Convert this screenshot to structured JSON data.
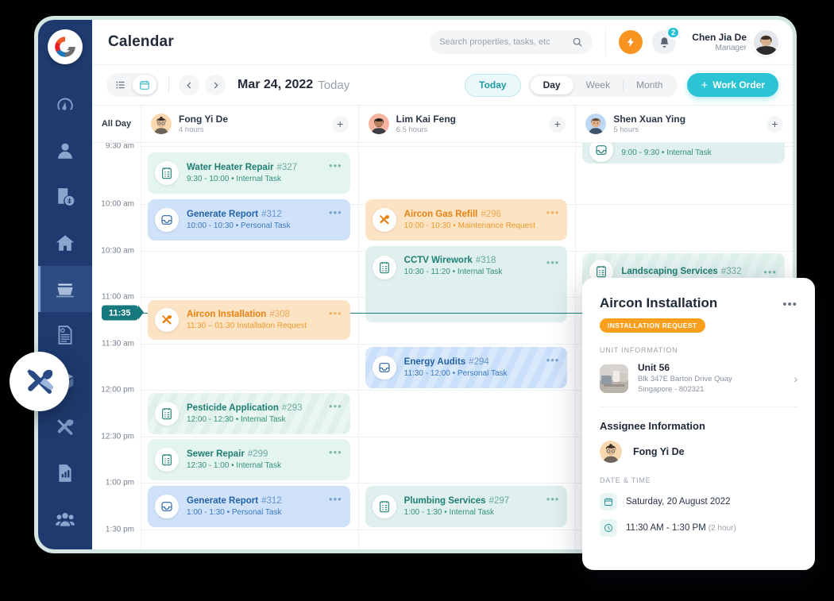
{
  "app": {
    "page_title": "Calendar",
    "search": {
      "placeholder": "Search properties, tasks, etc"
    },
    "notifications_count": "2",
    "user": {
      "name": "Chen Jia De",
      "role": "Manager"
    }
  },
  "toolbar": {
    "date": "Mar 24, 2022",
    "date_suffix": "Today",
    "today_label": "Today",
    "views": [
      "Day",
      "Week",
      "Month"
    ],
    "active_view": "Day",
    "work_order_label": "Work Order",
    "work_order_plus": "+"
  },
  "sidebar": {
    "items": [
      {
        "name": "logo",
        "icon": "brand-logo-icon"
      },
      {
        "name": "dashboard",
        "icon": "gauge-icon"
      },
      {
        "name": "tenants",
        "icon": "user-icon"
      },
      {
        "name": "billing",
        "icon": "invoice-dollar-icon"
      },
      {
        "name": "properties",
        "icon": "house-icon"
      },
      {
        "name": "calendar",
        "icon": "calendar-stack-icon",
        "active": true
      },
      {
        "name": "documents",
        "icon": "document-icon"
      },
      {
        "name": "inventory",
        "icon": "box-icon"
      },
      {
        "name": "maintenance",
        "icon": "tools-icon"
      },
      {
        "name": "reports",
        "icon": "bar-chart-doc-icon"
      },
      {
        "name": "team",
        "icon": "people-icon"
      }
    ]
  },
  "calendar": {
    "all_day_label": "All Day",
    "people": [
      {
        "name": "Fong Yi De",
        "hours": "4 hours",
        "add": "+"
      },
      {
        "name": "Lim Kai Feng",
        "hours": "6.5 hours",
        "add": "+"
      },
      {
        "name": "Shen Xuan Ying",
        "hours": "5 hours",
        "add": "+"
      }
    ],
    "time_labels": [
      "9:30 am",
      "10:00 am",
      "10:30 am",
      "11:00 am",
      "11:30 am",
      "12:00 pm",
      "12:30 pm",
      "1:00 pm",
      "1:30 pm"
    ],
    "now_time": "11:35",
    "events": [
      {
        "col": 0,
        "title": "Water Heater Repair",
        "id": "#327",
        "sub": "9:30 - 10:00 • Internal Task",
        "style": "green",
        "icon": "clipboard-icon",
        "dots": "•••"
      },
      {
        "col": 0,
        "title": "Generate Report",
        "id": "#312",
        "sub": "10:00 - 10:30 • Personal Task",
        "style": "blue",
        "icon": "tray-icon",
        "dots": "•••"
      },
      {
        "col": 0,
        "title": "Aircon Installation",
        "id": "#308",
        "sub": "11:30 – 01:30    Installation Request",
        "style": "orange",
        "icon": "tools-icon",
        "dots": "•••"
      },
      {
        "col": 0,
        "title": "Pesticide Application",
        "id": "#293",
        "sub": "12:00 - 12:30 • Internal Task",
        "style": "green stripe-g",
        "icon": "clipboard-icon",
        "dots": "•••"
      },
      {
        "col": 0,
        "title": "Sewer Repair",
        "id": "#299",
        "sub": "12:30 - 1:00 • Internal Task",
        "style": "green",
        "icon": "clipboard-icon",
        "dots": "•••"
      },
      {
        "col": 0,
        "title": "Generate Report",
        "id": "#312",
        "sub": "1:00 - 1:30 • Personal Task",
        "style": "blue",
        "icon": "tray-icon",
        "dots": "•••"
      },
      {
        "col": 1,
        "title": "Aircon Gas Refill",
        "id": "#296",
        "sub": "10:00 - 10:30 • Maintenance Request",
        "style": "orange",
        "icon": "tools-icon",
        "dots": "•••"
      },
      {
        "col": 1,
        "title": "CCTV Wirework",
        "id": "#318",
        "sub": "10:30 - 11:20 • Internal Task",
        "style": "teal",
        "icon": "clipboard-icon",
        "dots": "•••"
      },
      {
        "col": 1,
        "title": "Energy Audits",
        "id": "#294",
        "sub": "11:30 - 12:00 • Personal Task",
        "style": "blue stripe-b",
        "icon": "tray-icon",
        "dots": "•••"
      },
      {
        "col": 1,
        "title": "Plumbing Services",
        "id": "#297",
        "sub": "1:00 - 1:30 • Internal Task",
        "style": "teal",
        "icon": "clipboard-icon",
        "dots": "•••"
      },
      {
        "col": 2,
        "title": "",
        "id": "",
        "sub": "9:00 - 9:30 • Internal Task",
        "style": "teal",
        "icon": "tray-icon",
        "dots": ""
      },
      {
        "col": 2,
        "title": "Landscaping Services",
        "id": "#332",
        "sub": "",
        "style": "teal stripe-t",
        "icon": "clipboard-icon",
        "dots": "•••"
      }
    ]
  },
  "panel": {
    "title": "Aircon Installation",
    "dots": "•••",
    "tag": "INSTALLATION REQUEST",
    "unit_section_label": "UNIT INFORMATION",
    "unit_name": "Unit 56",
    "unit_address_line1": "Blk 347E Barton Drive Quay",
    "unit_address_line2": "Singapore - 802321",
    "chevron": "›",
    "assignee_section_label": "Assignee Information",
    "assignee_name": "Fong Yi De",
    "datetime_section_label": "DATE & TIME",
    "date_value": "Saturday, 20 August 2022",
    "time_value": "11:30 AM - 1:30 PM",
    "time_duration": "(2 hour)"
  },
  "colors": {
    "sidebar": "#1e3a6e",
    "accent_teal": "#2bc4d4",
    "accent_orange": "#f99f1c",
    "now_indicator": "#17787d"
  }
}
